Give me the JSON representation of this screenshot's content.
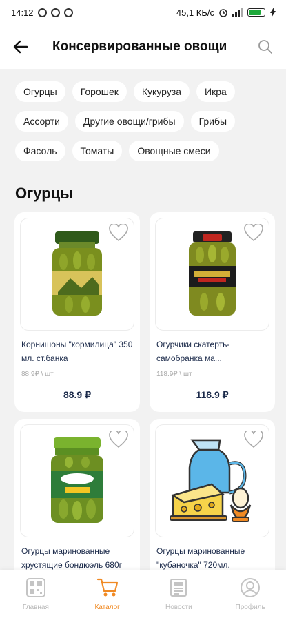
{
  "status_bar": {
    "time": "14:12",
    "net_speed": "45,1 КБ/с"
  },
  "header": {
    "title": "Консервированные овощи"
  },
  "chips": [
    "Огурцы",
    "Горошек",
    "Кукуруза",
    "Икра",
    "Ассорти",
    "Другие овощи/грибы",
    "Грибы",
    "Фасоль",
    "Томаты",
    "Овощные смеси"
  ],
  "section": {
    "title": "Огурцы"
  },
  "products": [
    {
      "name": "Корнишоны \"кормилица\" 350 мл. ст.банка",
      "unit": "88.9₽ \\ шт",
      "price": "88.9 ₽"
    },
    {
      "name": "Огурчики скатерть-самобранка ма...",
      "unit": "118.9₽ \\ шт",
      "price": "118.9 ₽"
    },
    {
      "name": "Огурцы маринованные хрустящие бондюэль 680г",
      "unit": "",
      "price": ""
    },
    {
      "name": "Огурцы маринованные \"кубаночка\" 720мл.",
      "unit": "",
      "price": ""
    }
  ],
  "bottom_nav": [
    {
      "label": "Главная",
      "icon": "qr-code-icon"
    },
    {
      "label": "Каталог",
      "icon": "shopping-cart-icon"
    },
    {
      "label": "Новости",
      "icon": "newspaper-icon"
    },
    {
      "label": "Профиль",
      "icon": "user-profile-icon"
    }
  ],
  "colors": {
    "accent": "#f08a24",
    "text_dark": "#1b2a4a",
    "background": "#f2f2f2"
  }
}
